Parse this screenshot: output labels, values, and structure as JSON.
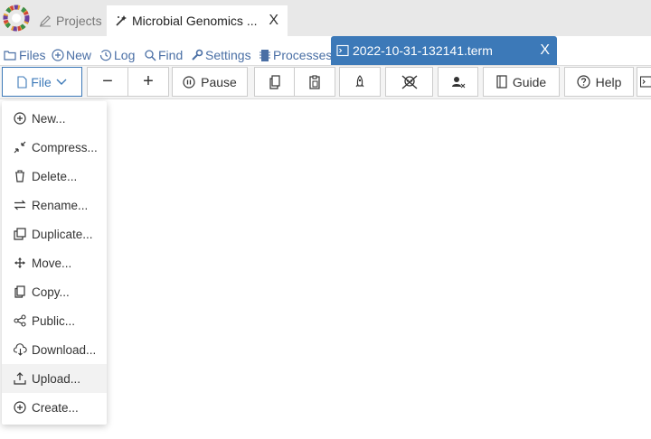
{
  "top_tabs": {
    "projects": "Projects",
    "active": "Microbial Genomics ...",
    "close": "X"
  },
  "sub_nav": {
    "files": "Files",
    "new": "New",
    "log": "Log",
    "find": "Find",
    "settings": "Settings",
    "processes": "Processes"
  },
  "terminal_tab": {
    "label": "2022-10-31-132141.term",
    "close": "X"
  },
  "toolbar": {
    "file": "File",
    "minus": "−",
    "plus": "+",
    "pause": "Pause",
    "guide": "Guide",
    "help": "Help"
  },
  "file_menu": {
    "items": [
      "New...",
      "Compress...",
      "Delete...",
      "Rename...",
      "Duplicate...",
      "Move...",
      "Copy...",
      "Public...",
      "Download...",
      "Upload...",
      "Create..."
    ]
  },
  "colors": {
    "accent": "#3c79b8",
    "link": "#4a6fa5",
    "topbar": "#e8e8e8"
  }
}
